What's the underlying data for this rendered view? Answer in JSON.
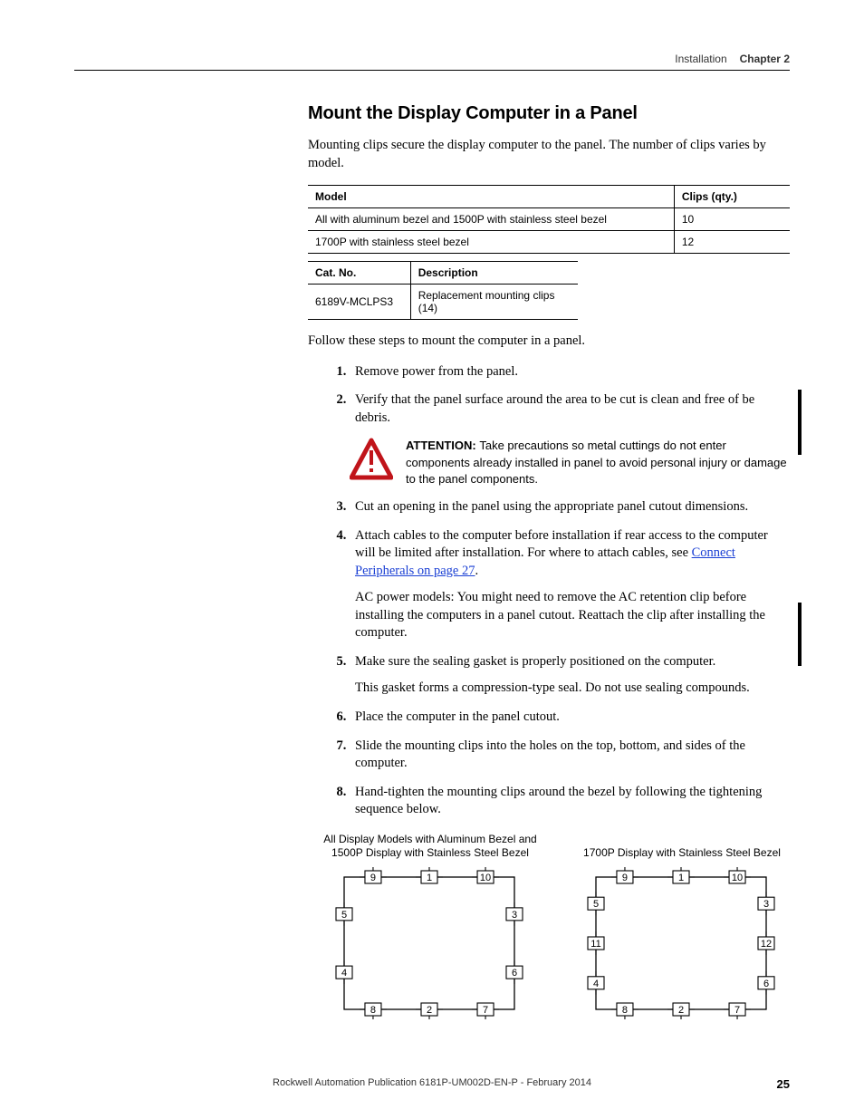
{
  "header": {
    "section": "Installation",
    "chapter": "Chapter 2"
  },
  "h2": "Mount the Display Computer in a Panel",
  "intro": "Mounting clips secure the display computer to the panel. The number of clips varies by model.",
  "table1": {
    "headers": [
      "Model",
      "Clips (qty.)"
    ],
    "rows": [
      [
        "All with aluminum bezel and 1500P with stainless steel bezel",
        "10"
      ],
      [
        "1700P with stainless steel bezel",
        "12"
      ]
    ]
  },
  "table2": {
    "headers": [
      "Cat. No.",
      "Description"
    ],
    "rows": [
      [
        "6189V-MCLPS3",
        "Replacement mounting clips (14)"
      ]
    ]
  },
  "follow": "Follow these steps to mount the computer in a panel.",
  "steps": {
    "s1": "Remove power from the panel.",
    "s2": "Verify that the panel surface around the area to be cut is clean and free of be debris.",
    "attention_label": "ATTENTION: ",
    "attention_body": "Take precautions so metal cuttings do not enter components already installed in panel to avoid personal injury or damage to the panel components.",
    "s3": "Cut an opening in the panel using the appropriate panel cutout dimensions.",
    "s4a": "Attach cables to the computer before installation if rear access to the computer will be limited after installation. For where to attach cables, see ",
    "s4_link": "Connect Peripherals on page 27",
    "s4b": ".",
    "s4_p2": "AC power models: You might need to remove the AC retention clip before installing the computers in a panel cutout. Reattach the clip after installing the computer.",
    "s5a": "Make sure the sealing gasket is properly positioned on the computer.",
    "s5b": "This gasket forms a compression-type seal. Do not use sealing compounds.",
    "s6": "Place the computer in the panel cutout.",
    "s7": "Slide the mounting clips into the holes on the top, bottom, and sides of the computer.",
    "s8": "Hand-tighten the mounting clips around the bezel by following the tightening sequence below."
  },
  "diagrams": {
    "left_title": "All Display Models with Aluminum Bezel and 1500P Display with Stainless Steel Bezel",
    "right_title": "1700P Display with Stainless Steel Bezel"
  },
  "chart_data": [
    {
      "type": "diagram",
      "title": "All Display Models with Aluminum Bezel and 1500P Display with Stainless Steel Bezel",
      "clips": [
        {
          "n": 9,
          "side": "top",
          "pos": 0.17
        },
        {
          "n": 1,
          "side": "top",
          "pos": 0.5
        },
        {
          "n": 10,
          "side": "top",
          "pos": 0.83
        },
        {
          "n": 5,
          "side": "left",
          "pos": 0.28
        },
        {
          "n": 4,
          "side": "left",
          "pos": 0.72
        },
        {
          "n": 3,
          "side": "right",
          "pos": 0.28
        },
        {
          "n": 6,
          "side": "right",
          "pos": 0.72
        },
        {
          "n": 8,
          "side": "bottom",
          "pos": 0.17
        },
        {
          "n": 2,
          "side": "bottom",
          "pos": 0.5
        },
        {
          "n": 7,
          "side": "bottom",
          "pos": 0.83
        }
      ]
    },
    {
      "type": "diagram",
      "title": "1700P Display with Stainless Steel Bezel",
      "clips": [
        {
          "n": 9,
          "side": "top",
          "pos": 0.17
        },
        {
          "n": 1,
          "side": "top",
          "pos": 0.5
        },
        {
          "n": 10,
          "side": "top",
          "pos": 0.83
        },
        {
          "n": 5,
          "side": "left",
          "pos": 0.2
        },
        {
          "n": 11,
          "side": "left",
          "pos": 0.5
        },
        {
          "n": 4,
          "side": "left",
          "pos": 0.8
        },
        {
          "n": 3,
          "side": "right",
          "pos": 0.2
        },
        {
          "n": 12,
          "side": "right",
          "pos": 0.5
        },
        {
          "n": 6,
          "side": "right",
          "pos": 0.8
        },
        {
          "n": 8,
          "side": "bottom",
          "pos": 0.17
        },
        {
          "n": 2,
          "side": "bottom",
          "pos": 0.5
        },
        {
          "n": 7,
          "side": "bottom",
          "pos": 0.83
        }
      ]
    }
  ],
  "footer": {
    "pub": "Rockwell Automation Publication 6181P-UM002D-EN-P - February 2014",
    "page": "25"
  }
}
